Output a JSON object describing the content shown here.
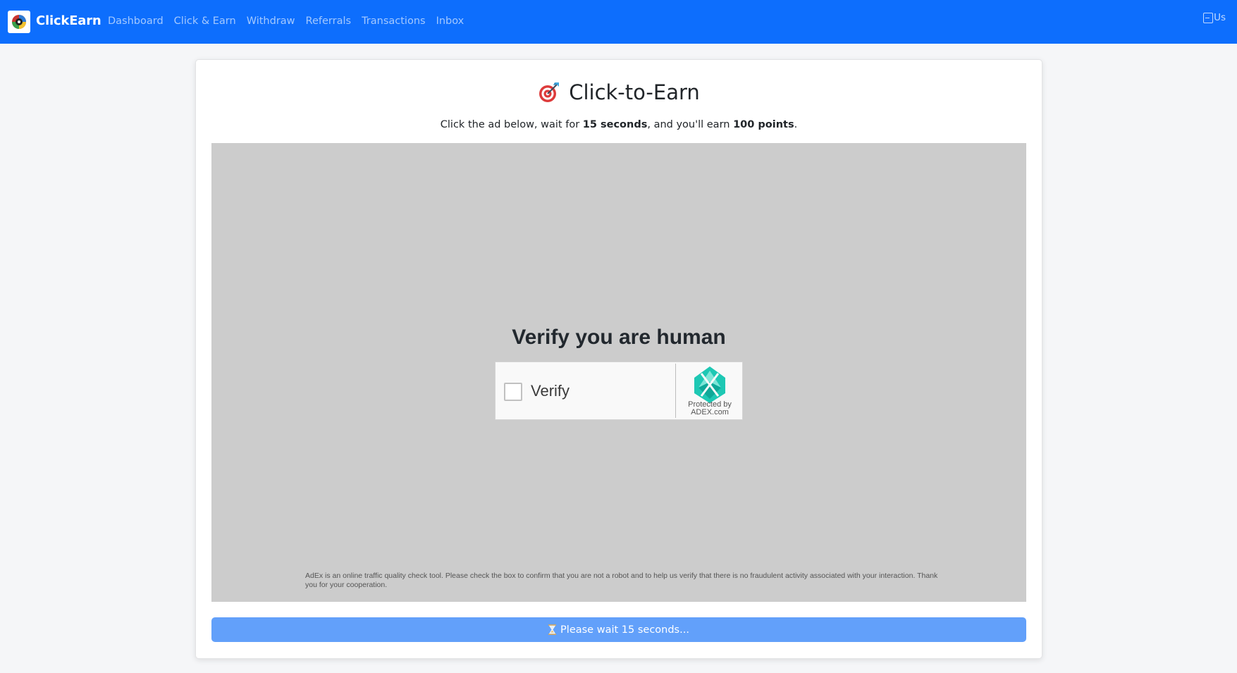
{
  "navbar": {
    "brand": "ClickEarn",
    "links": [
      "Dashboard",
      "Click & Earn",
      "Withdraw",
      "Referrals",
      "Transactions",
      "Inbox"
    ],
    "avatar_alt": "Us",
    "color": "#0d6efd"
  },
  "card": {
    "title": "Click-to-Earn",
    "title_icon": "dart-target-icon",
    "subtitle": {
      "prefix": "Click the ad below, wait for ",
      "seconds": "15 seconds",
      "middle": ", and you'll earn ",
      "points": "100 points",
      "suffix": "."
    },
    "ad": {
      "heading": "Verify you are human",
      "checkbox_label": "Verify",
      "protected_line1": "Protected by",
      "protected_line2": "ADEX.com",
      "disclaimer": "AdEx is an online traffic quality check tool. Please check the box to confirm that you are not a robot and to help us verify that there is no fraudulent activity associated with your interaction. Thank you for your cooperation.",
      "background": "#cccccc"
    },
    "wait_button": {
      "icon": "hourglass-icon",
      "label": "Please wait 15 seconds...",
      "color": "#62a0fa"
    }
  }
}
